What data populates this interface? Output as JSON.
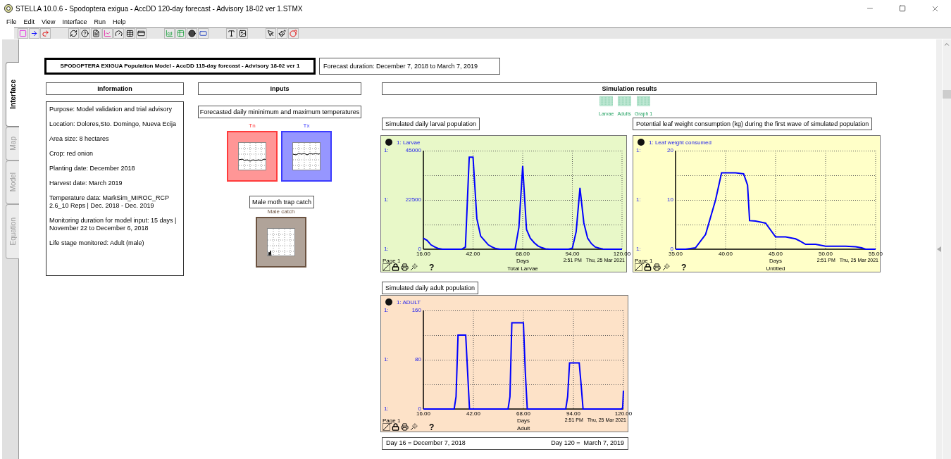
{
  "window": {
    "title": "STELLA 10.0.6 - Spodoptera exigua - AccDD 120-day forecast - Advisory 18-02 ver 1.STMX"
  },
  "menu": [
    "File",
    "Edit",
    "View",
    "Interface",
    "Run",
    "Help"
  ],
  "side_tabs": [
    {
      "label": "Interface",
      "selected": true
    },
    {
      "label": "Map",
      "selected": false
    },
    {
      "label": "Model",
      "selected": false
    },
    {
      "label": "Equation",
      "selected": false
    }
  ],
  "model_title": "SPODOPTERA EXIGUA Population Model - AccDD 115-day forecast - Advisory 18-02 ver 1",
  "forecast_duration": "Forecast duration: December 7, 2018 to March 7, 2019",
  "information": {
    "heading": "Information",
    "lines": [
      "Purpose: Model validation and trial advisory",
      "Location: Dolores,Sto. Domingo, Nueva Ecija",
      "Area size: 8 hectares",
      "Crop: red onion",
      "Planting date: December 2018",
      "Harvest date: March 2019",
      "Temperature data: MarkSim_MIROC_RCP 2.6_10 Reps | Dec. 2018 - Dec. 2019",
      "Monitoring duration for model input: 15 days | November 22 to December 6, 2018",
      "Life stage monitored: Adult (male)"
    ]
  },
  "inputs": {
    "heading": "Inputs",
    "temperature_caption": "Forecasted daily mininimum and maximum temperatures",
    "temperature_pads": [
      {
        "label": "Tn",
        "color": "#ff3b3b"
      },
      {
        "label": "Tx",
        "color": "#3b3bff"
      }
    ],
    "trap_caption": "Male moth trap catch",
    "trap_pad": {
      "label": "Male catch",
      "color": "#6b5240"
    }
  },
  "results": {
    "heading": "Simulation results",
    "buttons": [
      "Larvae",
      "Adults",
      "Graph 1"
    ]
  },
  "graphs": [
    {
      "caption": "Simulated daily larval population",
      "color": "#e8f8c8",
      "legend": "1:",
      "scale_labels": [
        "1:",
        "1:",
        "1:"
      ],
      "page": "Page 1",
      "time": "2:51 PM",
      "date": "Thu, 25 Mar 2021",
      "help": "?",
      "chart_data": {
        "type": "line",
        "grid": true,
        "title": "Total Larvae",
        "xlabel": "Days",
        "xlim": [
          16,
          120
        ],
        "ylim": [
          0,
          45000
        ],
        "yticks": [
          0,
          22500,
          45000
        ],
        "xticks": [
          {
            "value": 16,
            "label": "16.00"
          },
          {
            "value": 42,
            "label": "42.00"
          },
          {
            "value": 68,
            "label": "68.00"
          },
          {
            "value": 94,
            "label": "94.00"
          },
          {
            "value": 120,
            "label": "120.00"
          }
        ],
        "x": [
          16,
          18,
          20,
          22,
          24,
          26,
          28,
          30,
          32,
          34,
          36,
          38,
          40,
          42,
          44,
          46,
          48,
          50,
          52,
          54,
          56,
          58,
          60,
          62,
          64,
          66,
          68,
          70,
          72,
          74,
          76,
          78,
          80,
          82,
          84,
          86,
          88,
          90,
          92,
          94,
          96,
          98,
          100,
          102,
          104,
          106,
          108,
          110,
          112,
          114,
          116,
          118,
          120
        ],
        "series": [
          {
            "name": "Larvae",
            "color": "#0000ff",
            "values": [
              5000,
              4000,
              2000,
              1000,
              300,
              0,
              0,
              0,
              0,
              0,
              0,
              1000,
              42000,
              42000,
              14000,
              6000,
              4000,
              2000,
              1000,
              300,
              0,
              0,
              0,
              0,
              0,
              10000,
              38000,
              9000,
              5000,
              3000,
              1500,
              700,
              200,
              0,
              0,
              0,
              0,
              0,
              0,
              500,
              8000,
              28000,
              12000,
              5000,
              2500,
              1000,
              500,
              100,
              0,
              0,
              0,
              0,
              0
            ]
          }
        ]
      }
    },
    {
      "caption": "Potential leaf weight consumption (kg) during the first wave of simulated population",
      "color": "#ffffc8",
      "legend": "1:",
      "scale_labels": [
        "1:",
        "1:",
        "1:"
      ],
      "page": "Page 1",
      "time": "2:51 PM",
      "date": "Thu, 25 Mar 2021",
      "help": "?",
      "chart_data": {
        "type": "line",
        "grid": true,
        "title": "Untitled",
        "xlabel": "Days",
        "xlim": [
          35,
          55
        ],
        "ylim": [
          0,
          20
        ],
        "yticks": [
          0,
          10,
          20
        ],
        "xticks": [
          {
            "value": 35,
            "label": "35.00"
          },
          {
            "value": 40,
            "label": "40.00"
          },
          {
            "value": 45,
            "label": "45.00"
          },
          {
            "value": 50,
            "label": "50.00"
          },
          {
            "value": 55,
            "label": "55.00"
          }
        ],
        "x": [
          35,
          36,
          37,
          38,
          39,
          39.6,
          41,
          41.8,
          42.2,
          42.4,
          43,
          44,
          45,
          46,
          47,
          47.5,
          48,
          49,
          50,
          51,
          52,
          53,
          53.6,
          54,
          55
        ],
        "series": [
          {
            "name": "Leaf weight consumed",
            "color": "#0000ff",
            "values": [
              0,
              0,
              0.3,
              3,
              10,
              15.5,
              15.5,
              15.3,
              13,
              5.8,
              5.7,
              5.3,
              2.5,
              2.5,
              2.1,
              1.6,
              1,
              1,
              0.6,
              0.6,
              0.6,
              0.5,
              0.3,
              0,
              0
            ]
          }
        ]
      }
    },
    {
      "caption": "Simulated daily adult population",
      "color": "#fde2c8",
      "legend": "1:",
      "scale_labels": [
        "1:",
        "1:",
        "1:"
      ],
      "page": "Page 1",
      "time": "2:51 PM",
      "date": "Thu, 25 Mar 2021",
      "help": "?",
      "chart_data": {
        "type": "line",
        "grid": true,
        "title": "Adult",
        "xlabel": "Days",
        "xlim": [
          16,
          120
        ],
        "ylim": [
          0,
          160
        ],
        "yticks": [
          0,
          80,
          160
        ],
        "xticks": [
          {
            "value": 16,
            "label": "16.00"
          },
          {
            "value": 42,
            "label": "42.00"
          },
          {
            "value": 68,
            "label": "68.00"
          },
          {
            "value": 94,
            "label": "94.00"
          },
          {
            "value": 120,
            "label": "120.00"
          }
        ],
        "x": [
          16,
          32,
          33,
          34,
          38,
          39,
          40,
          60,
          61,
          62,
          68,
          69,
          70,
          90,
          91,
          92,
          97,
          98,
          99,
          119,
          119.6,
          120
        ],
        "series": [
          {
            "name": "ADULT",
            "color": "#0000ff",
            "values": [
              0,
              0,
              20,
              120,
              120,
              60,
              0,
              0,
              20,
              140,
              140,
              60,
              0,
              0,
              20,
              75,
              75,
              40,
              0,
              0,
              2,
              30
            ]
          }
        ]
      }
    }
  ],
  "day_note": {
    "left": "Day 16 = December 7, 2018",
    "right": "Day 120 =  March 7, 2019"
  }
}
